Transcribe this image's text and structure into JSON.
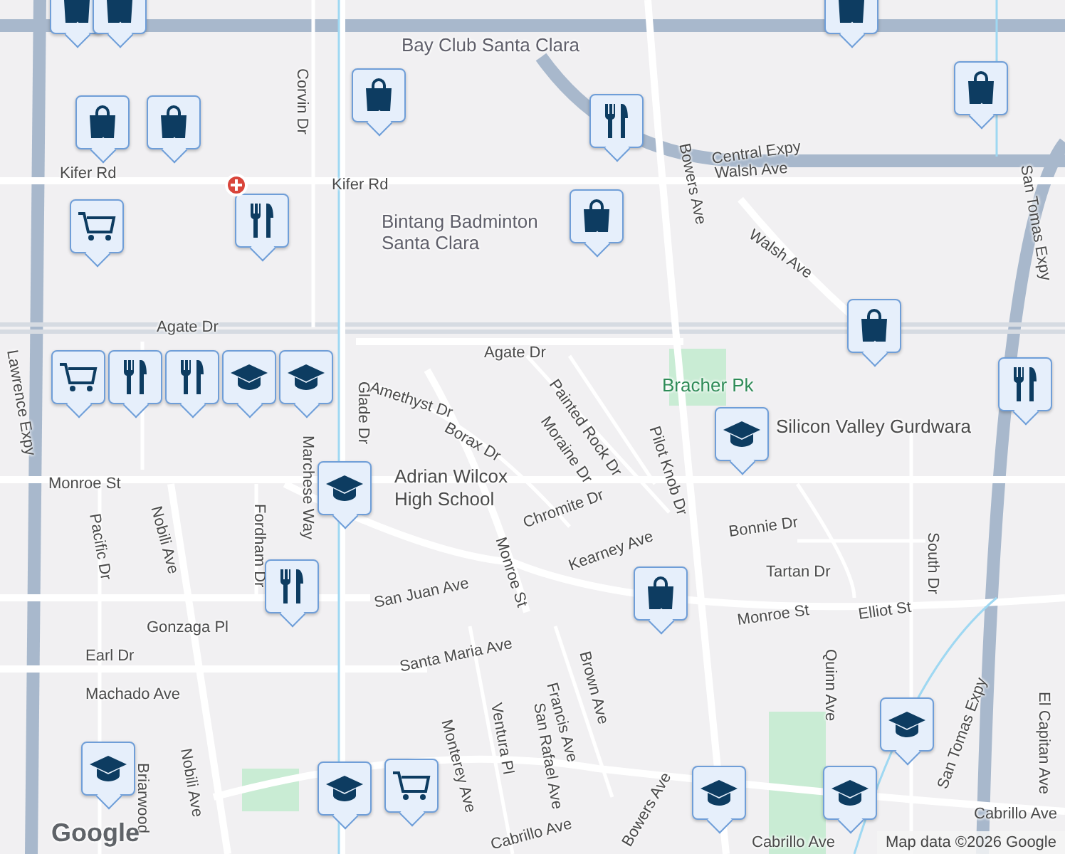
{
  "map": {
    "labels": [
      {
        "text": "Bay Club Santa Clara",
        "kind": "poi"
      },
      {
        "text": "Corvin Dr",
        "kind": "street"
      },
      {
        "text": "Kifer Rd",
        "kind": "street"
      },
      {
        "text": "Kifer Rd",
        "kind": "street"
      },
      {
        "text": "Central Expy",
        "kind": "street"
      },
      {
        "text": "Walsh Ave",
        "kind": "street"
      },
      {
        "text": "Bowers Ave",
        "kind": "street"
      },
      {
        "text": "Bintang Badminton",
        "kind": "poi"
      },
      {
        "text": "Santa Clara",
        "kind": "poi"
      },
      {
        "text": "Walsh Ave",
        "kind": "street"
      },
      {
        "text": "Agate Dr",
        "kind": "street"
      },
      {
        "text": "Agate Dr",
        "kind": "street"
      },
      {
        "text": "Bracher Pk",
        "kind": "park"
      },
      {
        "text": "Silicon Valley Gurdwara",
        "kind": "place"
      },
      {
        "text": "Amethyst Dr",
        "kind": "street"
      },
      {
        "text": "Glade Dr",
        "kind": "street"
      },
      {
        "text": "Marchese Way",
        "kind": "street"
      },
      {
        "text": "Borax Dr",
        "kind": "street"
      },
      {
        "text": "Moraine Dr",
        "kind": "street"
      },
      {
        "text": "Painted Rock Dr",
        "kind": "street"
      },
      {
        "text": "Pilot Knob Dr",
        "kind": "street"
      },
      {
        "text": "Adrian Wilcox",
        "kind": "place"
      },
      {
        "text": "High School",
        "kind": "place"
      },
      {
        "text": "Monroe St",
        "kind": "street"
      },
      {
        "text": "Monroe St",
        "kind": "street"
      },
      {
        "text": "Chromite Dr",
        "kind": "street"
      },
      {
        "text": "Kearney Ave",
        "kind": "street"
      },
      {
        "text": "Bonnie Dr",
        "kind": "street"
      },
      {
        "text": "Tartan Dr",
        "kind": "street"
      },
      {
        "text": "Monroe St",
        "kind": "street"
      },
      {
        "text": "Elliot St",
        "kind": "street"
      },
      {
        "text": "San Juan Ave",
        "kind": "street"
      },
      {
        "text": "Gonzaga Pl",
        "kind": "street"
      },
      {
        "text": "Earl Dr",
        "kind": "street"
      },
      {
        "text": "Machado Ave",
        "kind": "street"
      },
      {
        "text": "Santa Maria Ave",
        "kind": "street"
      },
      {
        "text": "Francis Ave",
        "kind": "street"
      },
      {
        "text": "Brown Ave",
        "kind": "street"
      },
      {
        "text": "San Rafael Ave",
        "kind": "street"
      },
      {
        "text": "Ventura Pl",
        "kind": "street"
      },
      {
        "text": "Monterey Ave",
        "kind": "street"
      },
      {
        "text": "Nobili Ave",
        "kind": "street"
      },
      {
        "text": "Nobili Ave",
        "kind": "street"
      },
      {
        "text": "Pacific Dr",
        "kind": "street"
      },
      {
        "text": "Fordham Dr",
        "kind": "street"
      },
      {
        "text": "Cabrillo Ave",
        "kind": "street"
      },
      {
        "text": "Cabrillo Ave",
        "kind": "street"
      },
      {
        "text": "Cabrillo Ave",
        "kind": "street"
      },
      {
        "text": "Quinn Ave",
        "kind": "street"
      },
      {
        "text": "South Dr",
        "kind": "street"
      },
      {
        "text": "San Tomas Expy",
        "kind": "street"
      },
      {
        "text": "San Tomas Expy",
        "kind": "street"
      },
      {
        "text": "Lawrence Expy",
        "kind": "street"
      },
      {
        "text": "Bowers Ave",
        "kind": "street"
      },
      {
        "text": "El Capitan Ave",
        "kind": "street"
      },
      {
        "text": "Briarwood",
        "kind": "street"
      }
    ],
    "markers": [
      {
        "kind": "shopping"
      },
      {
        "kind": "shopping"
      },
      {
        "kind": "shopping"
      },
      {
        "kind": "shopping"
      },
      {
        "kind": "shopping"
      },
      {
        "kind": "shopping"
      },
      {
        "kind": "shopping"
      },
      {
        "kind": "shopping"
      },
      {
        "kind": "shopping"
      },
      {
        "kind": "shopping"
      },
      {
        "kind": "restaurant"
      },
      {
        "kind": "restaurant"
      },
      {
        "kind": "restaurant"
      },
      {
        "kind": "restaurant"
      },
      {
        "kind": "restaurant"
      },
      {
        "kind": "restaurant"
      },
      {
        "kind": "grocery"
      },
      {
        "kind": "grocery"
      },
      {
        "kind": "grocery"
      },
      {
        "kind": "school"
      },
      {
        "kind": "school"
      },
      {
        "kind": "school"
      },
      {
        "kind": "school"
      },
      {
        "kind": "school"
      },
      {
        "kind": "school"
      },
      {
        "kind": "school"
      },
      {
        "kind": "school"
      },
      {
        "kind": "school"
      },
      {
        "kind": "hospital"
      }
    ],
    "logo": "Google",
    "attribution": "Map data ©2026 Google"
  }
}
